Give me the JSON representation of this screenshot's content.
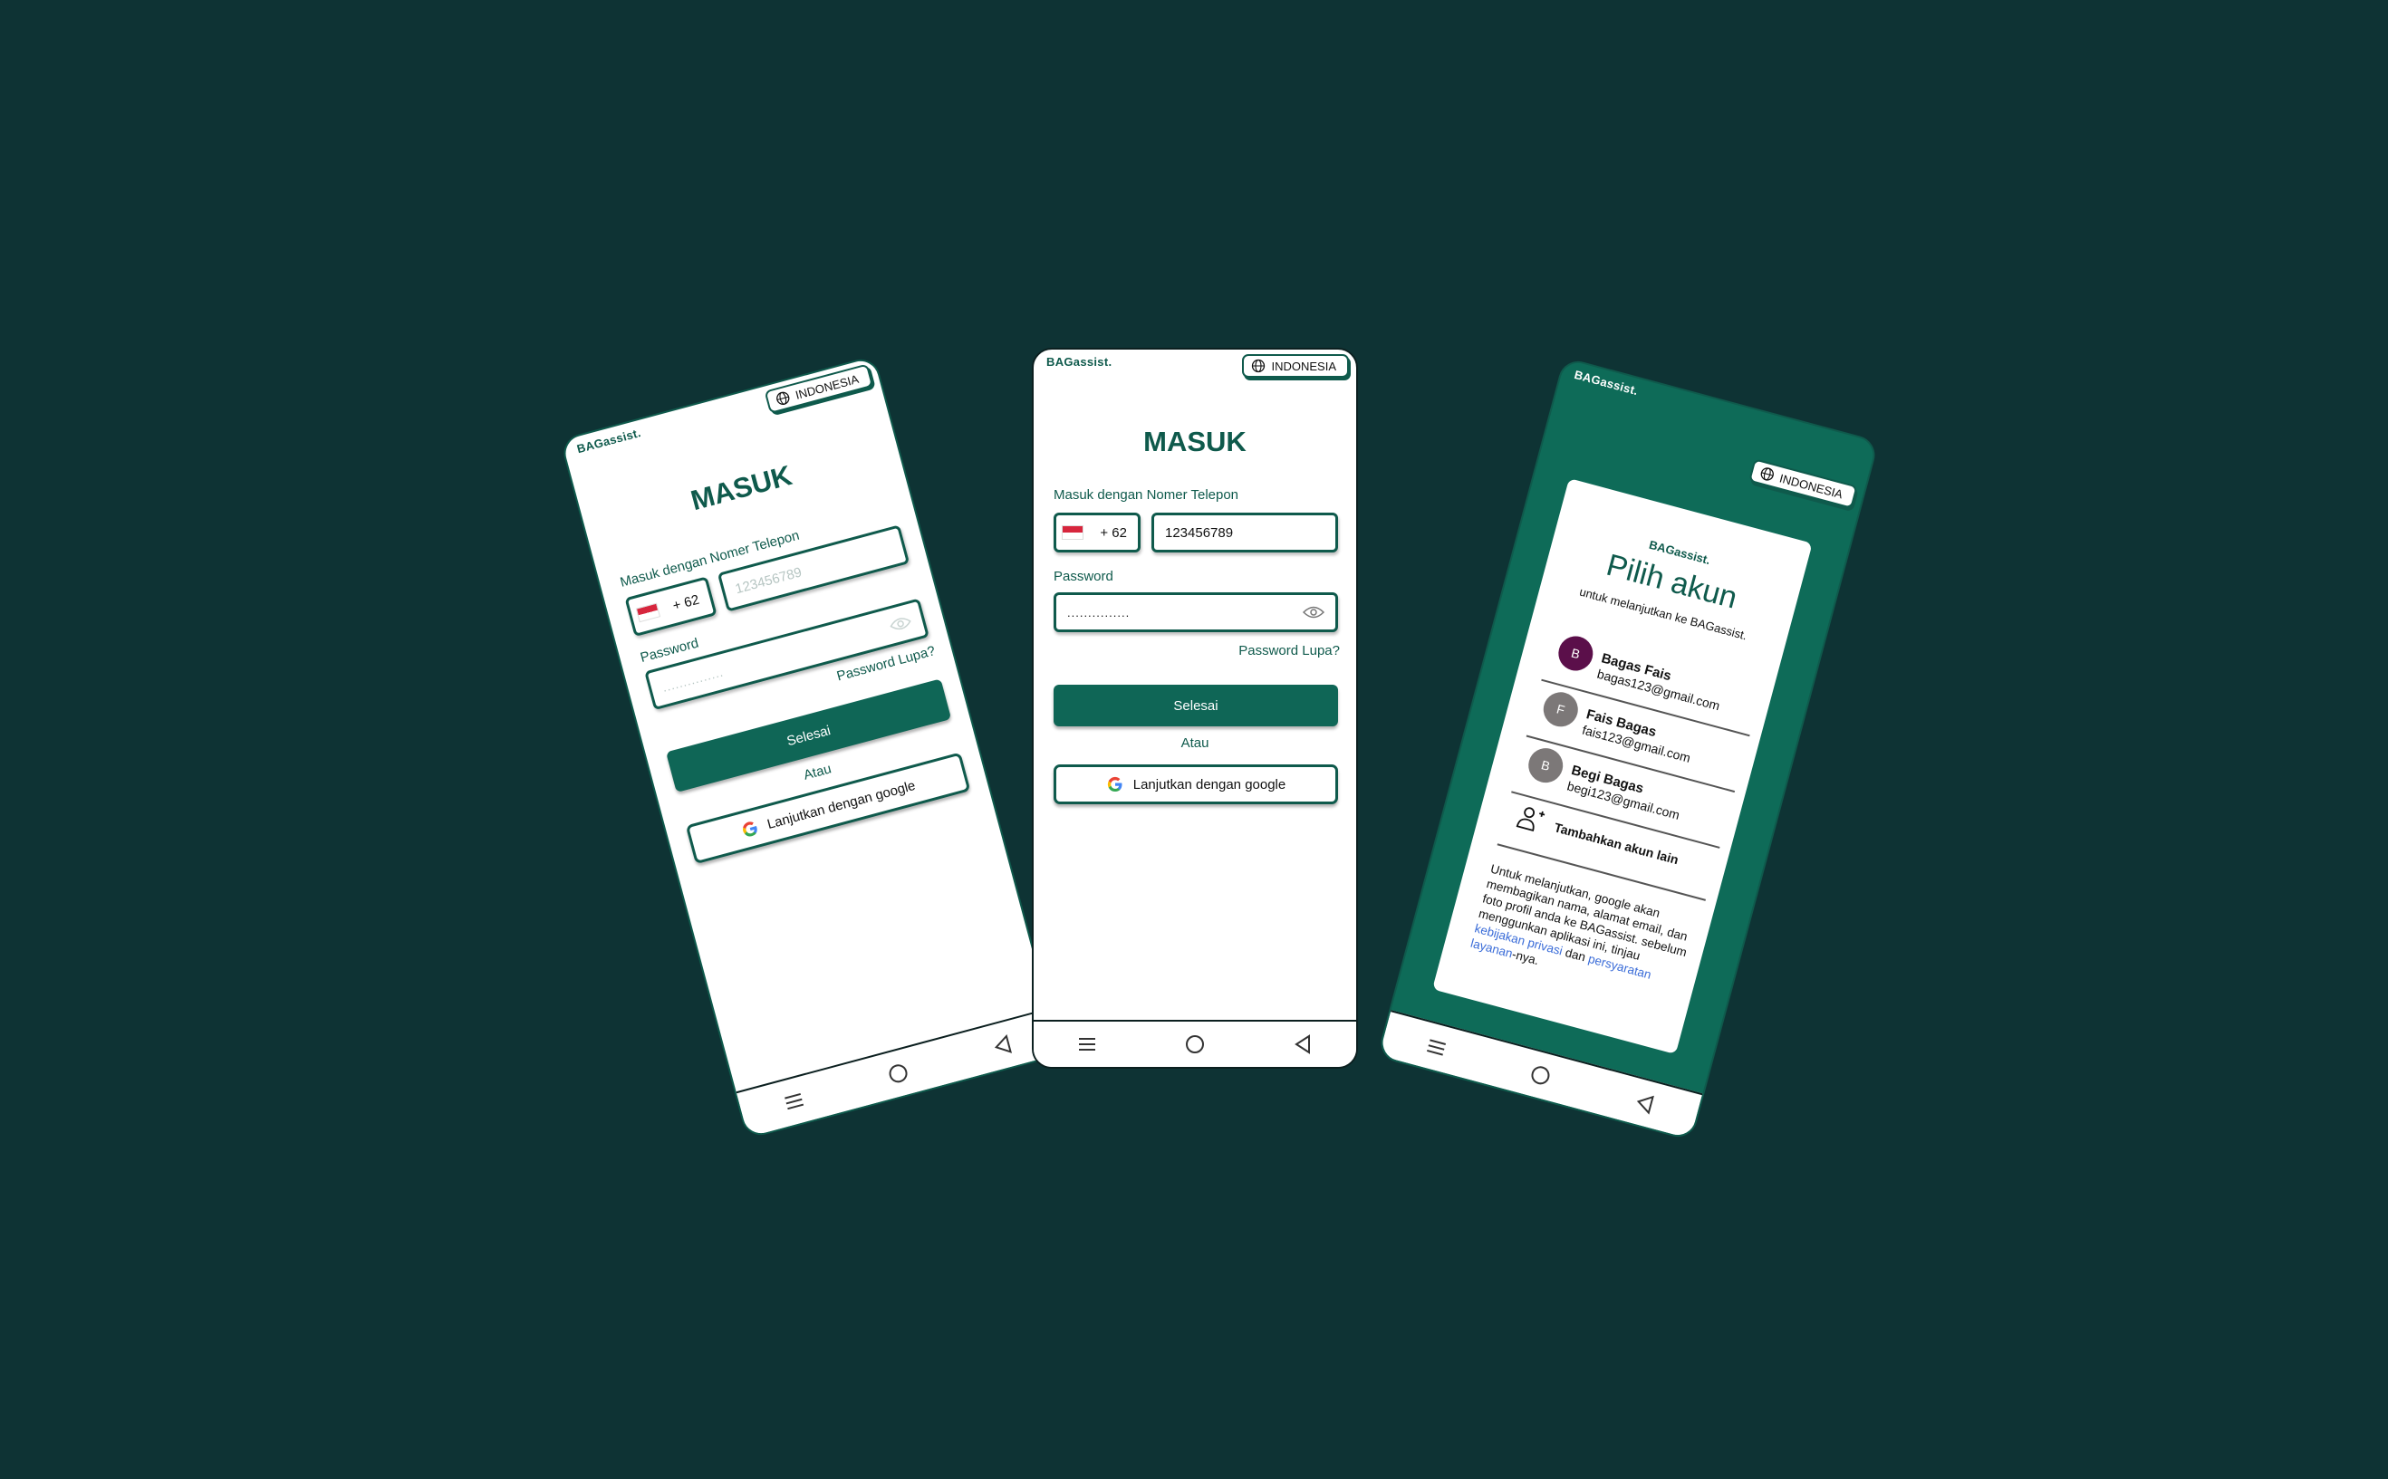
{
  "brand": "BAGassist.",
  "language": "INDONESIA",
  "login": {
    "title": "MASUK",
    "phone_label": "Masuk dengan Nomer Telepon",
    "country_code": "+ 62",
    "phone_placeholder": "123456789",
    "phone_value": "123456789",
    "password_label": "Password",
    "password_value": "...............",
    "forgot": "Password Lupa?",
    "submit": "Selesai",
    "or": "Atau",
    "google": "Lanjutkan dengan google"
  },
  "chooser": {
    "title": "Pilih akun",
    "subtitle": "untuk melanjutkan  ke BAGassist.",
    "accounts": [
      {
        "initial": "B",
        "name": "Bagas Fais",
        "email": "bagas123@gmail.com",
        "color": "#5b0f4a"
      },
      {
        "initial": "F",
        "name": "Fais Bagas",
        "email": "fais123@gmail.com",
        "color": "#7c7878"
      },
      {
        "initial": "B",
        "name": "Begi Bagas",
        "email": "begi123@gmail.com",
        "color": "#7c7878"
      }
    ],
    "add_account": "Tambahkan akun lain",
    "disclaimer_prefix": "Untuk melanjutkan, google akan membagikan nama, alamat email, dan foto profil anda ke BAGassist. sebelum menggunkan aplikasi ini, tinjau ",
    "link_privacy": "kebijakan privasi",
    "disclaimer_and": " dan ",
    "link_terms": "persyaratan layanan",
    "disclaimer_suffix": "-nya."
  },
  "colors": {
    "primary": "#0f5a4c",
    "background": "#0e3334"
  }
}
